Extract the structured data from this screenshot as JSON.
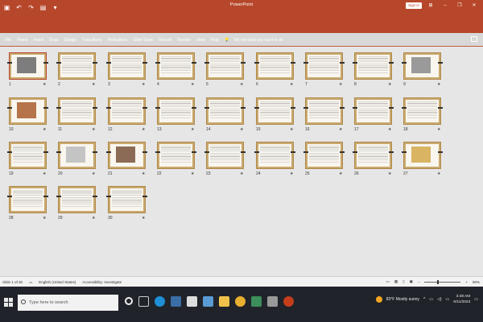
{
  "window": {
    "app_title": "PowerPoint",
    "signin_label": "Sign in"
  },
  "ribbon": {
    "tabs": [
      "File",
      "Home",
      "Insert",
      "Draw",
      "Design",
      "Transitions",
      "Animations",
      "Slide Show",
      "Record",
      "Review",
      "View",
      "Help"
    ],
    "tellme": "Tell me what you want to do"
  },
  "slides": {
    "numbers": [
      "1",
      "2",
      "3",
      "4",
      "5",
      "6",
      "7",
      "8",
      "9",
      "10",
      "11",
      "12",
      "13",
      "14",
      "15",
      "16",
      "17",
      "18",
      "19",
      "20",
      "21",
      "22",
      "23",
      "24",
      "25",
      "26",
      "27",
      "28",
      "29",
      "30"
    ],
    "selected": "1"
  },
  "statusbar": {
    "slide_info": "Slide 1 of 30",
    "language": "English (United States)",
    "accessibility": "Accessibility: Investigate",
    "zoom": "90%"
  },
  "taskbar": {
    "search_placeholder": "Type here to search",
    "weather": "83°F  Mostly sunny",
    "time": "3:38 AM",
    "date": "6/11/2023"
  },
  "colors": {
    "accent": "#b7472a",
    "slide_frame": "#c9a96e"
  }
}
